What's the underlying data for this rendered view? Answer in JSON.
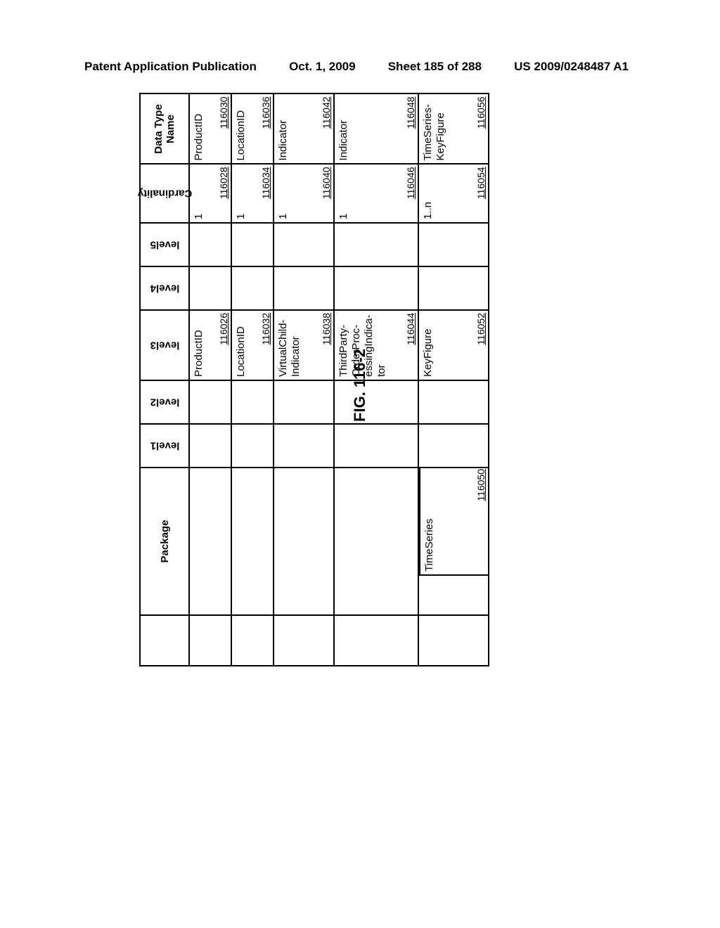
{
  "header": {
    "left": "Patent Application Publication",
    "date": "Oct. 1, 2009",
    "sheet": "Sheet 185 of 288",
    "pubnum": "US 2009/0248487 A1"
  },
  "figure_label": "FIG. 116-2",
  "columns": {
    "blank": "",
    "package": "Package",
    "l1": "level1",
    "l2": "level2",
    "l3": "level3",
    "l4": "level4",
    "l5": "level5",
    "card": "Cardinality",
    "dtn": "Data Type Name"
  },
  "rows": [
    {
      "package_text": "",
      "package_ref": "",
      "l3_text": "ProductID",
      "l3_ref": "116026",
      "card_text": "1",
      "card_ref": "116028",
      "dtn_text": "ProductID",
      "dtn_ref": "116030",
      "height_class": "r-a"
    },
    {
      "package_text": "",
      "package_ref": "",
      "l3_text": "LocationID",
      "l3_ref": "116032",
      "card_text": "1",
      "card_ref": "116034",
      "dtn_text": "LocationID",
      "dtn_ref": "116036",
      "height_class": "r-a"
    },
    {
      "package_text": "",
      "package_ref": "",
      "l3_text": "VirtualChild-Indicator",
      "l3_ref": "116038",
      "card_text": "1",
      "card_ref": "116040",
      "dtn_text": "Indicator",
      "dtn_ref": "116042",
      "height_class": "r-b"
    },
    {
      "package_text": "",
      "package_ref": "",
      "l3_text": "ThirdParty-OrderProc-essingIndica-tor",
      "l3_ref": "116044",
      "card_text": "1",
      "card_ref": "116046",
      "dtn_text": "Indicator",
      "dtn_ref": "116048",
      "height_class": "r-c"
    },
    {
      "package_text": "TimeSeries",
      "package_ref": "116050",
      "l3_text": "KeyFigure",
      "l3_ref": "116052",
      "card_text": "1..n",
      "card_ref": "116054",
      "dtn_text": "TimeSeries-KeyFigure",
      "dtn_ref": "116056",
      "height_class": "r-d"
    }
  ]
}
